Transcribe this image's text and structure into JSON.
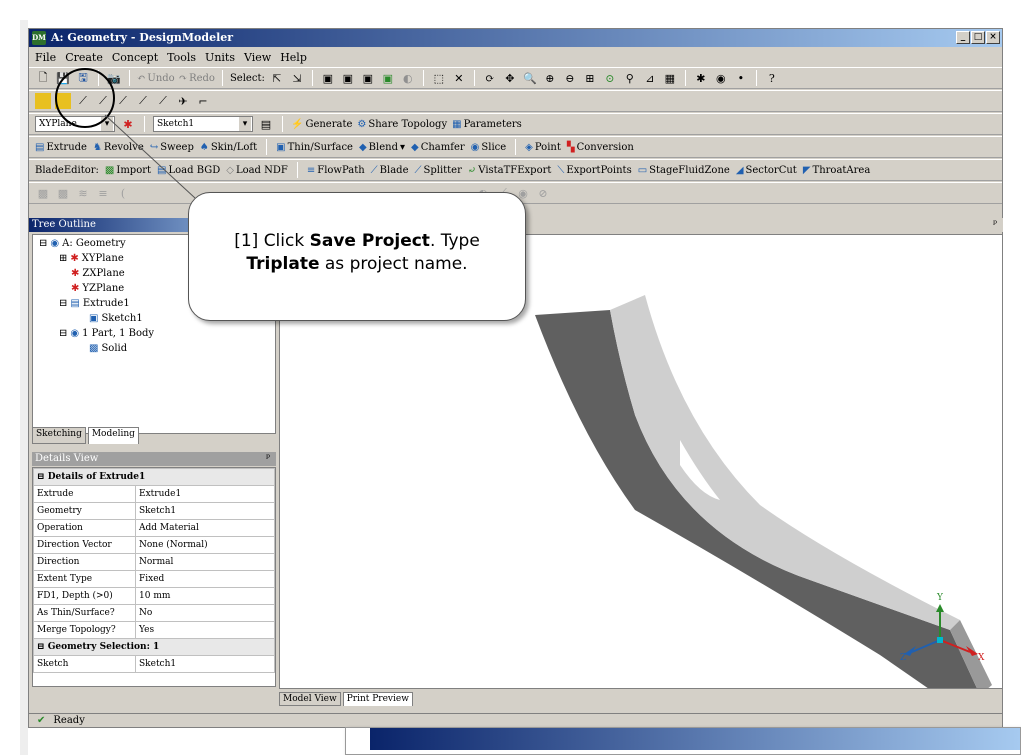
{
  "window": {
    "title": "A: Geometry - DesignModeler",
    "buttons": [
      "_",
      "□",
      "×"
    ]
  },
  "menu": [
    "File",
    "Create",
    "Concept",
    "Tools",
    "Units",
    "View",
    "Help"
  ],
  "toolbar1": {
    "undo": "Undo",
    "redo": "Redo",
    "select": "Select:"
  },
  "toolbar3": {
    "plane": "XYPlane",
    "sketch": "Sketch1",
    "generate": "Generate",
    "share": "Share Topology",
    "parameters": "Parameters"
  },
  "toolbar4": [
    "Extrude",
    "Revolve",
    "Sweep",
    "Skin/Loft",
    "Thin/Surface",
    "Blend",
    "Chamfer",
    "Slice",
    "Point",
    "Conversion"
  ],
  "toolbar5": [
    "BladeEditor:",
    "Import",
    "Load BGD",
    "Load NDF",
    "FlowPath",
    "Blade",
    "Splitter",
    "VistaTFExport",
    "ExportPoints",
    "StageFluidZone",
    "SectorCut",
    "ThroatArea"
  ],
  "tree": {
    "header": "Tree Outline",
    "nodes": [
      "A: Geometry",
      "XYPlane",
      "ZXPlane",
      "YZPlane",
      "Extrude1",
      "Sketch1",
      "1 Part, 1 Body",
      "Solid"
    ]
  },
  "tabs": {
    "sketching": "Sketching",
    "modeling": "Modeling"
  },
  "details": {
    "header": "Details View",
    "section1": "Details of Extrude1",
    "rows": [
      [
        "Extrude",
        "Extrude1"
      ],
      [
        "Geometry",
        "Sketch1"
      ],
      [
        "Operation",
        "Add Material"
      ],
      [
        "Direction Vector",
        "None (Normal)"
      ],
      [
        "Direction",
        "Normal"
      ],
      [
        "Extent Type",
        "Fixed"
      ],
      [
        "FD1, Depth (>0)",
        "10 mm"
      ],
      [
        "As Thin/Surface?",
        "No"
      ],
      [
        "Merge Topology?",
        "Yes"
      ]
    ],
    "section2": "Geometry Selection: 1",
    "rows2": [
      [
        "Sketch",
        "Sketch1"
      ]
    ]
  },
  "viewtabs": {
    "model": "Model View",
    "print": "Print Preview"
  },
  "status": {
    "text": "Ready"
  },
  "axes": {
    "x": "X",
    "y": "Y",
    "z": "Z"
  },
  "callout": {
    "line1_pre": "[1] Click ",
    "line1_bold": "Save Project",
    "line1_post": ". Type",
    "line2_bold": "Triplate",
    "line2_post": " as project name."
  },
  "colors": {
    "title": "#0a246a",
    "solid": "#666666",
    "accent": "#ffcc00"
  }
}
